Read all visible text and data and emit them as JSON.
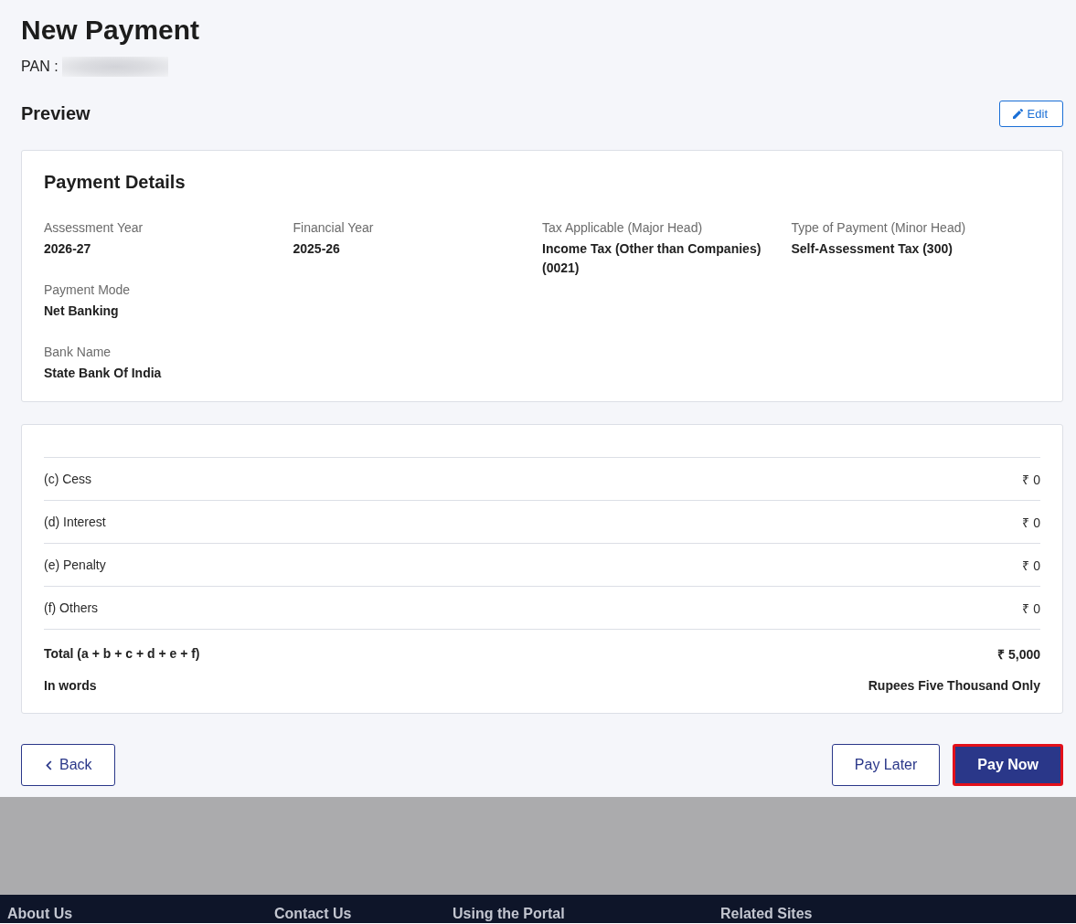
{
  "page": {
    "title": "New Payment",
    "pan_label": "PAN :"
  },
  "preview": {
    "title": "Preview",
    "edit_button": "Edit"
  },
  "payment_details": {
    "title": "Payment Details",
    "rows": [
      [
        {
          "label": "Assessment Year",
          "value": "2026-27"
        },
        {
          "label": "Financial Year",
          "value": "2025-26"
        },
        {
          "label": "Tax Applicable (Major Head)",
          "value": "Income Tax (Other than Companies) (0021)"
        },
        {
          "label": "Type of Payment (Minor Head)",
          "value": "Self-Assessment Tax (300)"
        }
      ],
      [
        {
          "label": "Payment Mode",
          "value": "Net Banking"
        }
      ],
      [
        {
          "label": "Bank Name",
          "value": "State Bank Of India"
        }
      ]
    ]
  },
  "tax_breakup": {
    "rows": [
      {
        "label": "(c) Cess",
        "amount": "₹ 0"
      },
      {
        "label": "(d) Interest",
        "amount": "₹ 0"
      },
      {
        "label": "(e) Penalty",
        "amount": "₹ 0"
      },
      {
        "label": "(f) Others",
        "amount": "₹ 0"
      }
    ],
    "totals": [
      {
        "label": "Total (a + b + c + d + e + f)",
        "value": "₹ 5,000"
      },
      {
        "label": "In words",
        "value": "Rupees Five Thousand Only"
      }
    ]
  },
  "actions": {
    "back": {
      "label": "Back"
    },
    "buttons": [
      {
        "label": "Pay Later",
        "kind": "outline",
        "highlighted": false
      },
      {
        "label": "Pay Now",
        "kind": "primary",
        "highlighted": true
      }
    ]
  },
  "footer": {
    "headings": [
      "About Us",
      "Contact Us",
      "Using the Portal",
      "Related Sites"
    ]
  }
}
